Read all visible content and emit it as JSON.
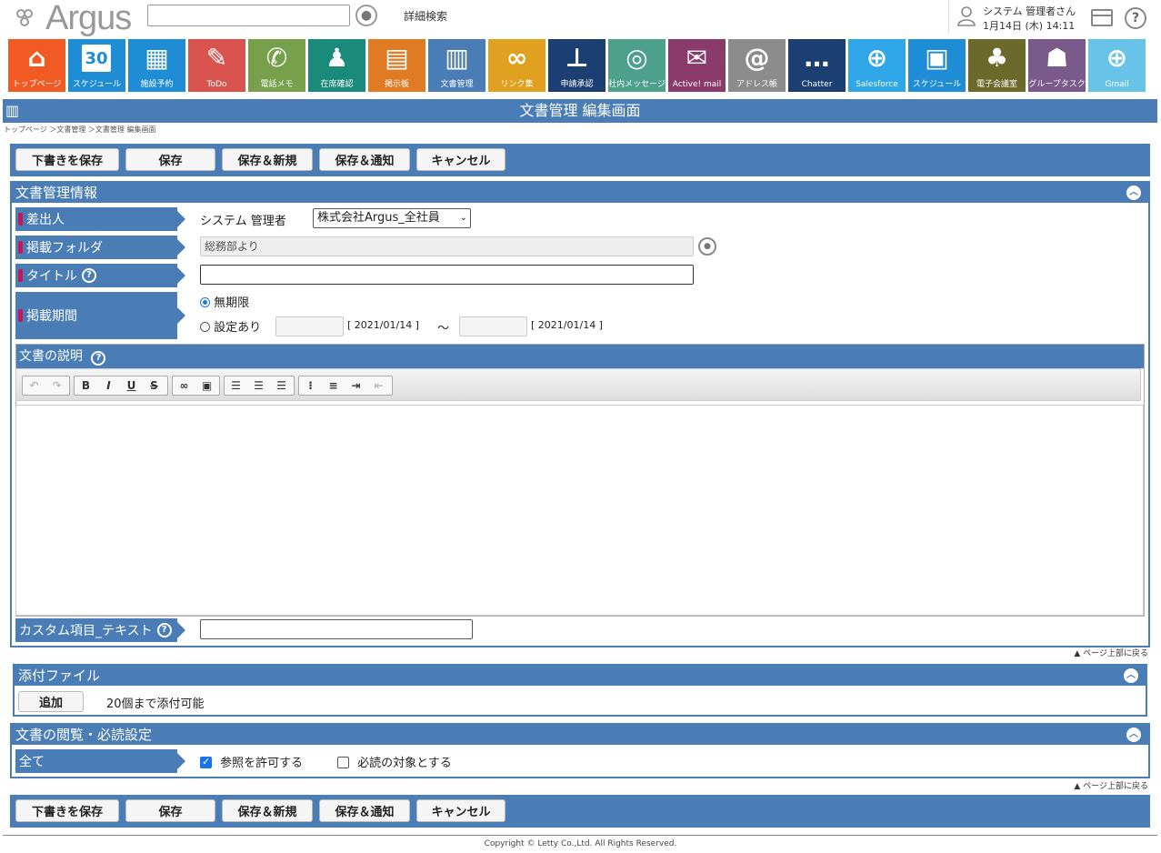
{
  "header": {
    "logo": "Argus",
    "search_placeholder": "",
    "advanced_search": "詳細検索",
    "user_name": "システム 管理者さん",
    "user_datetime": "1月14日 (木) 14:11"
  },
  "apps": [
    {
      "label": "トップページ",
      "color": "#f15a22",
      "icon": "⌂"
    },
    {
      "label": "スケジュール",
      "color": "#1f8dd6",
      "icon": "30"
    },
    {
      "label": "施設予約",
      "color": "#1f8dd6",
      "icon": "▦"
    },
    {
      "label": "ToDo",
      "color": "#d9534f",
      "icon": "✎"
    },
    {
      "label": "電話メモ",
      "color": "#76a04b",
      "icon": "✆"
    },
    {
      "label": "在席確認",
      "color": "#1a8a7a",
      "icon": "♟"
    },
    {
      "label": "掲示板",
      "color": "#e07b24",
      "icon": "▤"
    },
    {
      "label": "文書管理",
      "color": "#4a7db5",
      "icon": "▥"
    },
    {
      "label": "リンク集",
      "color": "#e0a020",
      "icon": "∞"
    },
    {
      "label": "申請承認",
      "color": "#1b3f73",
      "icon": "⊥"
    },
    {
      "label": "社内メッセージ",
      "color": "#4da08c",
      "icon": "◎"
    },
    {
      "label": "Active! mail",
      "color": "#8a3a6b",
      "icon": "✉"
    },
    {
      "label": "アドレス帳",
      "color": "#8c8c8c",
      "icon": "@"
    },
    {
      "label": "Chatter",
      "color": "#1b3f73",
      "icon": "…"
    },
    {
      "label": "Salesforce",
      "color": "#2fa6e8",
      "icon": "⊕"
    },
    {
      "label": "スケジュール",
      "color": "#1f8dd6",
      "icon": "▣"
    },
    {
      "label": "電子会議室",
      "color": "#6b6a2a",
      "icon": "♣"
    },
    {
      "label": "グループタスク",
      "color": "#7a5a8a",
      "icon": "☗"
    },
    {
      "label": "Gmail",
      "color": "#67c3e8",
      "icon": "⊕"
    }
  ],
  "page": {
    "title": "文書管理 編集画面",
    "breadcrumb": "トップページ ＞文書管理 ＞文書管理 編集画面"
  },
  "actions": {
    "draft": "下書きを保存",
    "save": "保存",
    "save_new": "保存＆新規",
    "save_notify": "保存＆通知",
    "cancel": "キャンセル"
  },
  "info": {
    "heading": "文書管理情報",
    "sender_label": "差出人",
    "sender_name": "システム 管理者",
    "sender_group": "株式会社Argus_全社員",
    "folder_label": "掲載フォルダ",
    "folder_value": "総務部より",
    "title_label": "タイトル",
    "title_value": "",
    "period_label": "掲載期間",
    "period_unlimited": "無期限",
    "period_set": "設定あり",
    "start_hint": "[ 2021/01/14 ]",
    "tilde": "～",
    "end_hint": "[ 2021/01/14 ]",
    "desc_label": "文書の説明",
    "custom_label": "カスタム項目_テキスト",
    "custom_value": ""
  },
  "back_to_top": "▲ ページ上部に戻る",
  "attach": {
    "heading": "添付ファイル",
    "add": "追加",
    "note": "20個まで添付可能"
  },
  "reading": {
    "heading": "文書の閲覧・必読設定",
    "scope": "全て",
    "allow_view": "参照を許可する",
    "allow_view_checked": true,
    "must_read": "必読の対象とする",
    "must_read_checked": false
  },
  "footer": {
    "copyright": "Copyright © Letty Co.,Ltd. All Rights Reserved."
  }
}
